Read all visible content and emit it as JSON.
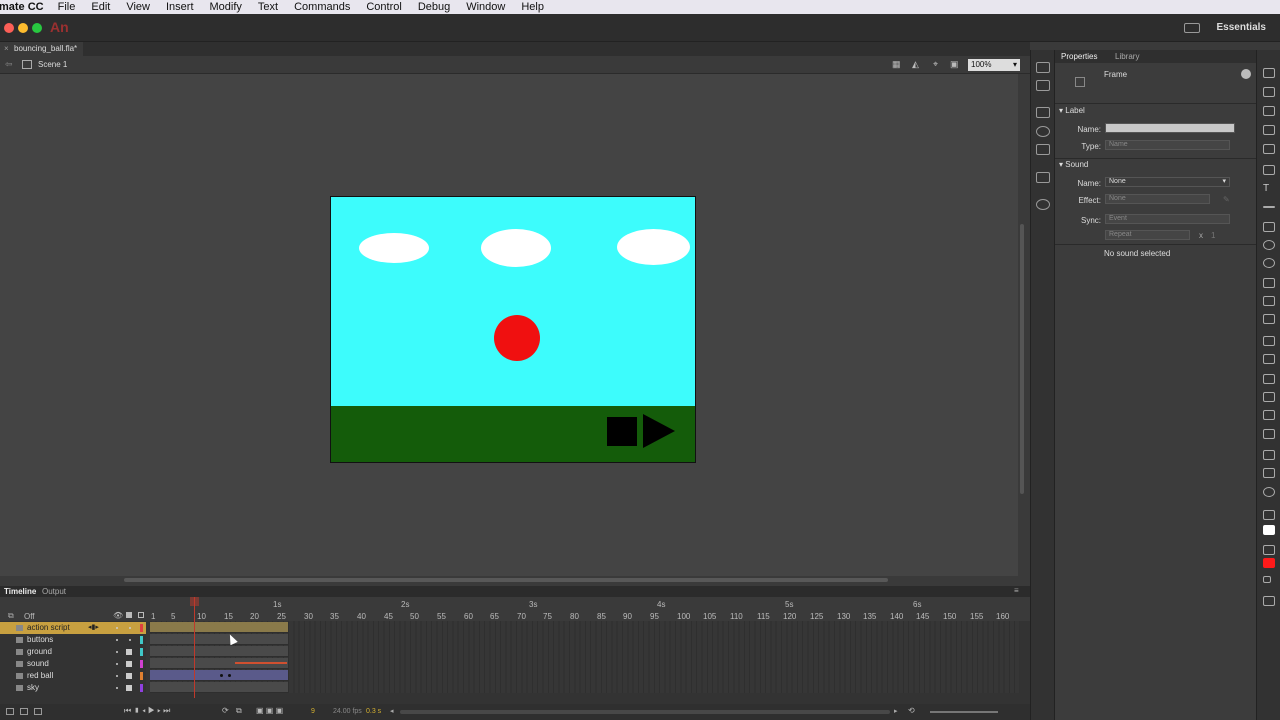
{
  "menubar": {
    "app": "mate CC",
    "items": [
      "File",
      "Edit",
      "View",
      "Insert",
      "Modify",
      "Text",
      "Commands",
      "Control",
      "Debug",
      "Window",
      "Help"
    ]
  },
  "window": {
    "logo": "An",
    "workspace": "Essentials"
  },
  "document": {
    "tab": "bouncing_ball.fla*",
    "scene": "Scene 1",
    "zoom": "100%"
  },
  "properties": {
    "tabs": [
      "Properties",
      "Library"
    ],
    "type_title": "Frame",
    "label_section": "Label",
    "name_label": "Name:",
    "type_label": "Type:",
    "type_value": "Name",
    "sound_section": "Sound",
    "sound_name_label": "Name:",
    "sound_name_value": "None",
    "effect_label": "Effect:",
    "effect_value": "None",
    "sync_label": "Sync:",
    "sync_value": "Event",
    "repeat_value": "Repeat",
    "repeat_x": "x",
    "repeat_count": "1",
    "status": "No sound selected"
  },
  "timeline": {
    "tabs": [
      "Timeline",
      "Output"
    ],
    "onion": "Off",
    "seconds": [
      "1s",
      "2s",
      "3s",
      "4s",
      "5s",
      "6s"
    ],
    "frames": [
      "1",
      "5",
      "10",
      "15",
      "20",
      "25",
      "30",
      "35",
      "40",
      "45",
      "50",
      "55",
      "60",
      "65",
      "70",
      "75",
      "80",
      "85",
      "90",
      "95",
      "100",
      "105",
      "110",
      "115",
      "120",
      "125",
      "130",
      "135",
      "140",
      "145",
      "150",
      "155",
      "160"
    ],
    "layers": [
      {
        "name": "action script",
        "color": "#e04040"
      },
      {
        "name": "buttons",
        "color": "#40c8c8"
      },
      {
        "name": "ground",
        "color": "#40c8c8"
      },
      {
        "name": "sound",
        "color": "#d040d0"
      },
      {
        "name": "red ball",
        "color": "#e08030"
      },
      {
        "name": "sky",
        "color": "#9040e0"
      }
    ],
    "current_frame": "9",
    "fps": "24.00 fps",
    "elapsed": "0.3 s"
  },
  "colors": {
    "sky": "#3dfcfc",
    "ground": "#145c0a",
    "ball": "#f01010",
    "stroke_swatch": "#ffffff",
    "fill_swatch": "#ff1a1a"
  }
}
